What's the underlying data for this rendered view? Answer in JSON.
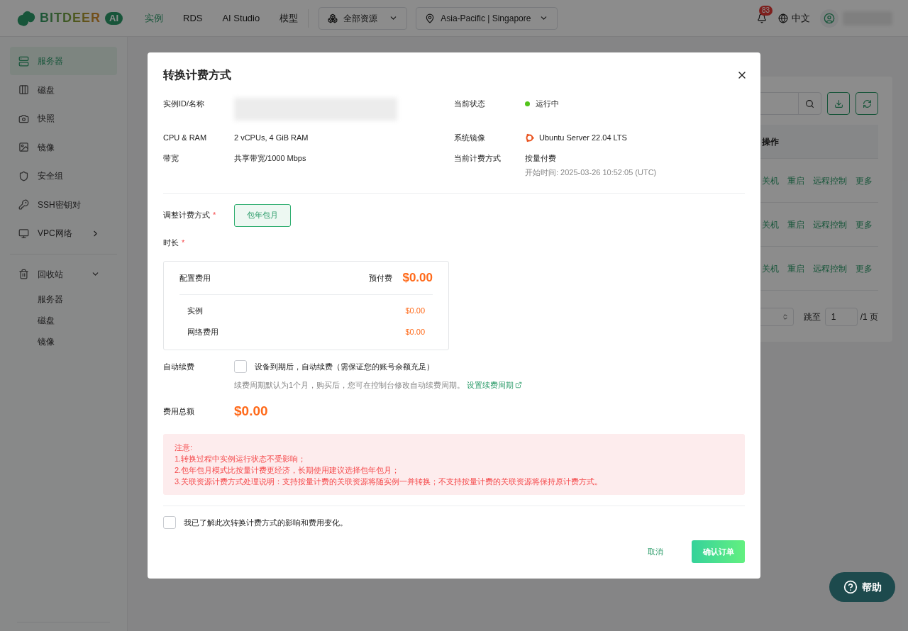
{
  "topbar": {
    "logo": {
      "text": "BITDEER",
      "badge": "AI"
    },
    "nav": [
      {
        "label": "实例",
        "selected": true
      },
      {
        "label": "RDS",
        "selected": false
      },
      {
        "label": "AI Studio",
        "selected": false
      },
      {
        "label": "模型",
        "selected": false
      }
    ],
    "resource_select": "全部资源",
    "region_select": "Asia-Pacific | Singapore",
    "notification_count": "83",
    "language": "中文"
  },
  "sidebar": {
    "items": [
      {
        "label": "服务器",
        "selected": true
      },
      {
        "label": "磁盘",
        "selected": false
      },
      {
        "label": "快照",
        "selected": false
      },
      {
        "label": "镜像",
        "selected": false
      },
      {
        "label": "安全组",
        "selected": false
      },
      {
        "label": "SSH密钥对",
        "selected": false
      },
      {
        "label": "VPC网络",
        "selected": false,
        "expanded": false
      }
    ],
    "recycle": {
      "label": "回收站",
      "expanded": true,
      "children": [
        {
          "label": "服务器"
        },
        {
          "label": "磁盘"
        },
        {
          "label": "镜像"
        }
      ]
    }
  },
  "page": {
    "table": {
      "columns": [
        "操作"
      ],
      "rows": [
        {
          "actions": [
            "关机",
            "重启",
            "远程控制",
            "更多"
          ]
        },
        {
          "actions": [
            "关机",
            "重启",
            "远程控制",
            "更多"
          ]
        },
        {
          "actions": [
            "关机",
            "重启",
            "远程控制",
            "更多"
          ]
        }
      ]
    },
    "pagination": {
      "jump_label": "跳至",
      "jump_value": "1",
      "total_pages": "/1 页"
    }
  },
  "dialog": {
    "title": "转换计费方式",
    "info": [
      {
        "label": "实例ID/名称",
        "kind": "redacted"
      },
      {
        "label": "当前状态",
        "kind": "status",
        "value": "运行中",
        "color": "#52c41a"
      },
      {
        "label": "CPU & RAM",
        "kind": "text",
        "value": "2 vCPUs, 4 GiB RAM"
      },
      {
        "label": "系统镜像",
        "kind": "os",
        "value": "Ubuntu Server 22.04 LTS"
      },
      {
        "label": "带宽",
        "kind": "text",
        "value": "共享带宽/1000 Mbps"
      },
      {
        "label": "当前计费方式",
        "kind": "text",
        "value": "按量付费",
        "note": "开始时间: 2025-03-26 10:52:05 (UTC)"
      }
    ],
    "required_mark": "*",
    "billing_label": "调整计费方式",
    "billing_options": [
      {
        "label": "包年包月",
        "selected": true
      }
    ],
    "duration_label": "时长",
    "fees": {
      "title": "配置费用",
      "prepaid_label": "预付费",
      "prepaid": "$0.00",
      "items": [
        {
          "label": "实例",
          "value": "$0.00"
        },
        {
          "label": "网络费用",
          "value": "$0.00"
        }
      ]
    },
    "auto_renew": {
      "label": "自动续费",
      "checked": false,
      "text": "设备到期后，自动续费（需保证您的账号余额充足）",
      "hint": "续费周期默认为1个月，购买后，您可在控制台修改自动续费周期。",
      "link": "设置续费周期"
    },
    "total_label": "费用总额",
    "total": "$0.00",
    "notice": [
      "注意:",
      "1.转换过程中实例运行状态不受影响；",
      "2.包年包月模式比按量计费更经济，长期使用建议选择包年包月；",
      "3.关联资源计费方式处理说明：支持按量计费的关联资源将随实例一并转换；不支持按量计费的关联资源将保持原计费方式。"
    ],
    "acknowledge": {
      "text": "我已了解此次转换计费方式的影响和费用变化。",
      "checked": false
    },
    "cancel": "取消",
    "confirm": "确认订单"
  },
  "help": "帮助"
}
